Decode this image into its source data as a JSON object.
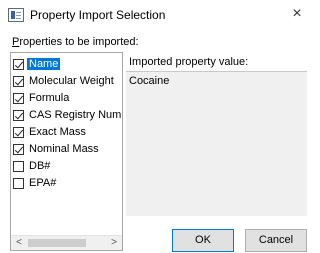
{
  "window": {
    "title": "Property Import Selection",
    "close_glyph": "×"
  },
  "properties": {
    "label_accel": "P",
    "label_rest": "roperties to be imported:",
    "items": [
      {
        "label": "Name",
        "checked": true,
        "selected": true
      },
      {
        "label": "Molecular Weight",
        "checked": true,
        "selected": false
      },
      {
        "label": "Formula",
        "checked": true,
        "selected": false
      },
      {
        "label": "CAS Registry Number",
        "checked": true,
        "selected": false
      },
      {
        "label": "Exact Mass",
        "checked": true,
        "selected": false
      },
      {
        "label": "Nominal Mass",
        "checked": true,
        "selected": false
      },
      {
        "label": "DB#",
        "checked": false,
        "selected": false
      },
      {
        "label": "EPA#",
        "checked": false,
        "selected": false
      }
    ]
  },
  "scrollbar": {
    "left_glyph": "<",
    "right_glyph": ">"
  },
  "value": {
    "label": "Imported property value:",
    "text": "Cocaine"
  },
  "buttons": {
    "ok": "OK",
    "cancel": "Cancel"
  },
  "colors": {
    "selection": "#0078d7",
    "button_face": "#e1e1e1",
    "value_bg": "#f0f0f0"
  }
}
